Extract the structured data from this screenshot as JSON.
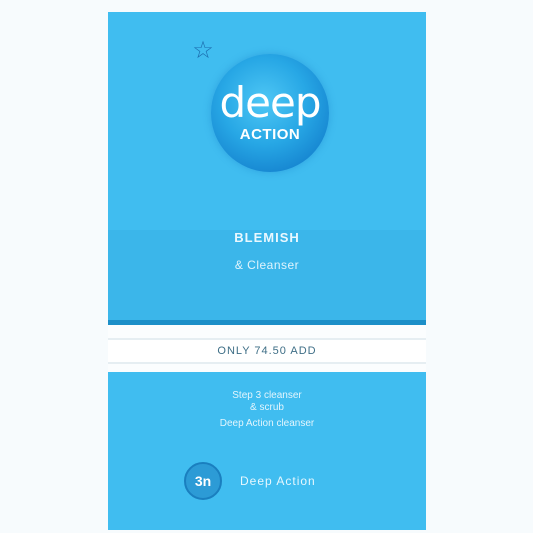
{
  "card": {
    "logo_word": "deep",
    "logo_sub": "ACTION",
    "favorite_icon": "star-icon",
    "product_line1": "BLEMISH",
    "product_line2": "& Cleanser",
    "price_text": "ONLY 74.50 ADD",
    "description_line1": "Step 3 cleanser",
    "description_line2": "& scrub",
    "description_line3": "Deep Action cleanser",
    "cta_icon": "play-icon",
    "cta_icon_text": "3n",
    "cta_label": "Deep Action"
  },
  "colors": {
    "panel": "#40bdf0",
    "rule": "#1c8fc8",
    "logo_dark": "#0d6fc0"
  }
}
